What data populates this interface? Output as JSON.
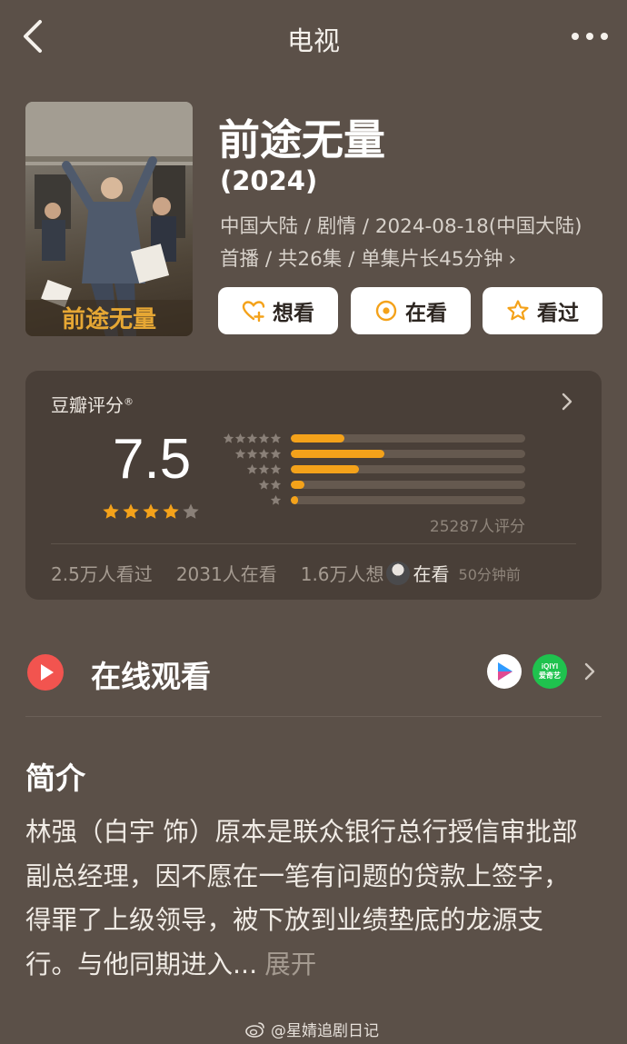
{
  "topbar": {
    "title": "电视"
  },
  "show": {
    "title": "前途无量",
    "year": "(2024)",
    "meta": "中国大陆 / 剧情 / 2024-08-18(中国大陆)首播 / 共26集 / 单集片长45分钟",
    "poster_text": "前途无量"
  },
  "actions": [
    {
      "label": "想看",
      "icon": "heart-plus-icon"
    },
    {
      "label": "在看",
      "icon": "target-icon"
    },
    {
      "label": "看过",
      "icon": "star-outline-icon"
    }
  ],
  "rating": {
    "label": "豆瓣评分",
    "registered": "®",
    "score": "7.5",
    "stars_filled": 4,
    "stars_total": 5,
    "distribution": [
      {
        "stars": 5,
        "fraction": 0.23
      },
      {
        "stars": 4,
        "fraction": 0.4
      },
      {
        "stars": 3,
        "fraction": 0.29
      },
      {
        "stars": 2,
        "fraction": 0.06
      },
      {
        "stars": 1,
        "fraction": 0.03
      }
    ],
    "rater_count": "25287人评分",
    "watched": "2.5万人看过",
    "watching": "2031人在看",
    "want": "1.6万人想",
    "friend_status": "在看",
    "friend_time": "50分钟前"
  },
  "watch_online": {
    "title": "在线观看",
    "platforms": [
      {
        "name": "youku-icon"
      },
      {
        "name": "iqiyi-icon",
        "text_top": "iQIYI",
        "text_bottom": "爱奇艺"
      }
    ]
  },
  "intro": {
    "heading": "简介",
    "text": "林强（白宇 饰）原本是联众银行总行授信审批部副总经理，因不愿在一笔有问题的贷款上签字，得罪了上级领导，被下放到业绩垫底的龙源支行。与他同期进入...",
    "expand": "展开"
  },
  "watermark": "@星婧追剧日记",
  "colors": {
    "background": "#5b5048",
    "card": "#493f38",
    "accent": "#f4a21a",
    "play_red": "#f2544f",
    "iqiyi_green": "#1fc24e"
  }
}
